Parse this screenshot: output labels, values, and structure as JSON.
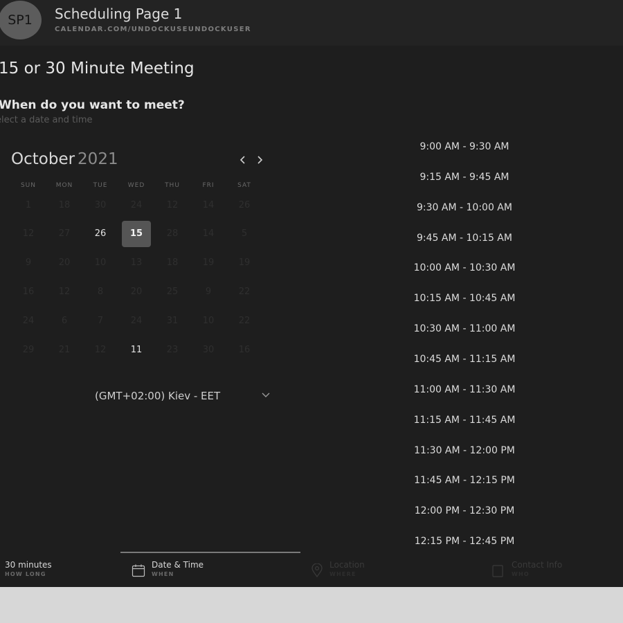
{
  "header": {
    "avatar_initials": "SP1",
    "title": "Scheduling Page 1",
    "url": "CALENDAR.COM/UNDOCKUSEUNDOCKUSER"
  },
  "meeting_title": "15 or 30 Minute Meeting",
  "question": "When do you want to meet?",
  "subtitle": "elect a date and time",
  "calendar": {
    "month": "October",
    "year": "2021",
    "prev_icon": "chevron-left-icon",
    "next_icon": "chevron-right-icon",
    "weekdays": [
      "SUN",
      "MON",
      "TUE",
      "WED",
      "THU",
      "FRI",
      "SAT"
    ],
    "rows": [
      [
        {
          "text": "1",
          "state": "disabled"
        },
        {
          "text": "18",
          "state": "disabled"
        },
        {
          "text": "30",
          "state": "disabled"
        },
        {
          "text": "24",
          "state": "disabled"
        },
        {
          "text": "12",
          "state": "disabled"
        },
        {
          "text": "14",
          "state": "disabled"
        },
        {
          "text": "26",
          "state": "disabled"
        }
      ],
      [
        {
          "text": "12",
          "state": "disabled"
        },
        {
          "text": "27",
          "state": "disabled"
        },
        {
          "text": "26",
          "state": "available"
        },
        {
          "text": "15",
          "state": "selected"
        },
        {
          "text": "28",
          "state": "disabled"
        },
        {
          "text": "14",
          "state": "disabled"
        },
        {
          "text": "5",
          "state": "disabled"
        }
      ],
      [
        {
          "text": "9",
          "state": "disabled"
        },
        {
          "text": "20",
          "state": "disabled"
        },
        {
          "text": "10",
          "state": "disabled"
        },
        {
          "text": "13",
          "state": "disabled"
        },
        {
          "text": "18",
          "state": "disabled"
        },
        {
          "text": "19",
          "state": "disabled"
        },
        {
          "text": "19",
          "state": "disabled"
        }
      ],
      [
        {
          "text": "16",
          "state": "disabled"
        },
        {
          "text": "12",
          "state": "disabled"
        },
        {
          "text": "8",
          "state": "disabled"
        },
        {
          "text": "20",
          "state": "disabled"
        },
        {
          "text": "25",
          "state": "disabled"
        },
        {
          "text": "9",
          "state": "disabled"
        },
        {
          "text": "22",
          "state": "disabled"
        }
      ],
      [
        {
          "text": "24",
          "state": "disabled"
        },
        {
          "text": "6",
          "state": "disabled"
        },
        {
          "text": "7",
          "state": "disabled"
        },
        {
          "text": "24",
          "state": "disabled"
        },
        {
          "text": "31",
          "state": "disabled"
        },
        {
          "text": "10",
          "state": "disabled"
        },
        {
          "text": "22",
          "state": "disabled"
        }
      ],
      [
        {
          "text": "29",
          "state": "disabled"
        },
        {
          "text": "21",
          "state": "disabled"
        },
        {
          "text": "12",
          "state": "disabled"
        },
        {
          "text": "11",
          "state": "available"
        },
        {
          "text": "23",
          "state": "disabled"
        },
        {
          "text": "30",
          "state": "disabled"
        },
        {
          "text": "16",
          "state": "disabled"
        }
      ]
    ]
  },
  "timezone": {
    "label": "(GMT+02:00) Kiev - EET",
    "icon": "chevron-down-icon"
  },
  "time_slots": [
    "9:00 AM - 9:30 AM",
    "9:15 AM - 9:45 AM",
    "9:30 AM - 10:00 AM",
    "9:45 AM - 10:15 AM",
    "10:00 AM - 10:30 AM",
    "10:15 AM - 10:45 AM",
    "10:30 AM - 11:00 AM",
    "10:45 AM - 11:15 AM",
    "11:00 AM - 11:30 AM",
    "11:15 AM - 11:45 AM",
    "11:30 AM - 12:00 PM",
    "11:45 AM - 12:15 PM",
    "12:00 PM - 12:30 PM",
    "12:15 PM - 12:45 PM"
  ],
  "steps": {
    "duration": {
      "label": "30 minutes",
      "sub": "HOW LONG"
    },
    "datetime": {
      "label": "Date & Time",
      "sub": "WHEN",
      "icon": "calendar-icon"
    },
    "location": {
      "label": "Location",
      "sub": "WHERE",
      "icon": "location-pin-icon"
    },
    "contact": {
      "label": "Contact Info",
      "sub": "WHO",
      "icon": "contact-card-icon"
    }
  },
  "colors": {
    "page_background": "#1e1e1e",
    "header_background": "#232323",
    "selected_day": "#555555",
    "outer_background": "#d7d7d7"
  }
}
